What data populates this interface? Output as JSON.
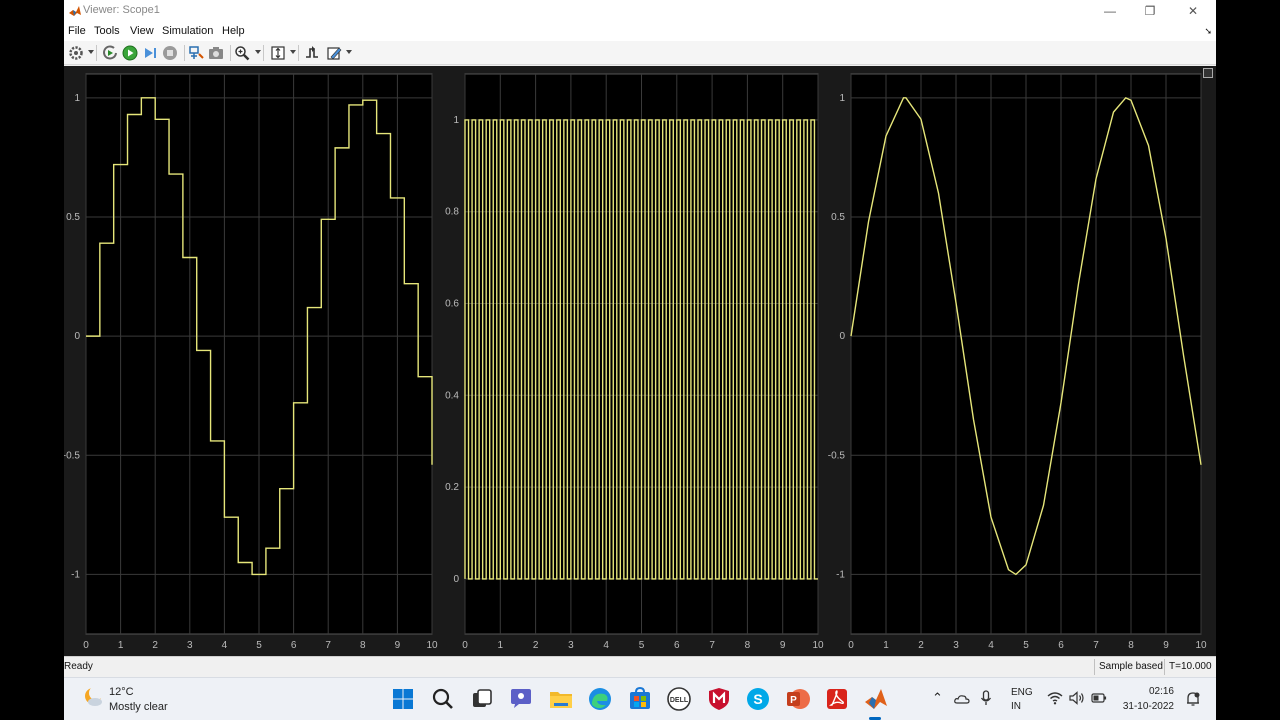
{
  "window": {
    "title": "Viewer: Scope1",
    "minimize": "—",
    "restore": "❐",
    "close": "✕"
  },
  "menu": {
    "items": [
      "File",
      "Tools",
      "View",
      "Simulation",
      "Help"
    ],
    "overflow_arrow": "➘"
  },
  "toolbar": {
    "icons": [
      "gear-icon",
      "run-back-icon",
      "run-icon",
      "step-forward-icon",
      "stop-icon",
      "highlight-block-icon",
      "snapshot-icon",
      "zoom-icon",
      "autoscale-icon",
      "triggers-icon",
      "style-icon"
    ]
  },
  "plots": [
    {
      "name": "staircase-sine",
      "ylim": [
        -1.25,
        1.1
      ],
      "yticks": [
        "1",
        "0.5",
        "0",
        "-0.5",
        "-1"
      ],
      "xticks": [
        "0",
        "1",
        "2",
        "3",
        "4",
        "5",
        "6",
        "7",
        "8",
        "9",
        "10"
      ]
    },
    {
      "name": "pulse-train",
      "ylim": [
        -0.12,
        1.1
      ],
      "yticks": [
        "1",
        "0.8",
        "0.6",
        "0.4",
        "0.2",
        "0"
      ],
      "xticks": [
        "0",
        "1",
        "2",
        "3",
        "4",
        "5",
        "6",
        "7",
        "8",
        "9",
        "10"
      ]
    },
    {
      "name": "sine",
      "ylim": [
        -1.25,
        1.1
      ],
      "yticks": [
        "1",
        "0.5",
        "0",
        "-0.5",
        "-1"
      ],
      "xticks": [
        "0",
        "1",
        "2",
        "3",
        "4",
        "5",
        "6",
        "7",
        "8",
        "9",
        "10"
      ]
    }
  ],
  "chart_data": [
    {
      "type": "line",
      "style": "step",
      "x": [
        0,
        0.4,
        0.8,
        1.2,
        1.6,
        2.0,
        2.4,
        2.8,
        3.2,
        3.6,
        4.0,
        4.4,
        4.8,
        5.2,
        5.6,
        6.0,
        6.4,
        6.8,
        7.2,
        7.6,
        8.0,
        8.4,
        8.8,
        9.2,
        9.6,
        10.0
      ],
      "y": [
        0,
        0.39,
        0.72,
        0.93,
        1.0,
        0.91,
        0.68,
        0.33,
        -0.06,
        -0.44,
        -0.76,
        -0.95,
        -1.0,
        -0.89,
        -0.64,
        -0.28,
        0.12,
        0.49,
        0.79,
        0.97,
        0.99,
        0.85,
        0.58,
        0.22,
        -0.17,
        -0.54
      ],
      "xlim": [
        0,
        10
      ],
      "ylim": [
        -1.25,
        1.1
      ],
      "grid": true,
      "line_color": "#e6e67a"
    },
    {
      "type": "line",
      "style": "pulse",
      "period": 0.2,
      "duty": 0.5,
      "amplitude": 1,
      "xlim": [
        0,
        10
      ],
      "ylim": [
        -0.12,
        1.1
      ],
      "grid": true,
      "line_color": "#e6e67a"
    },
    {
      "type": "line",
      "style": "smooth",
      "function": "sin(x)",
      "x": [
        0,
        0.5,
        1.0,
        1.5,
        1.57,
        2.0,
        2.5,
        3.0,
        3.5,
        4.0,
        4.5,
        4.71,
        5.0,
        5.5,
        6.0,
        6.5,
        7.0,
        7.5,
        7.85,
        8.0,
        8.5,
        9.0,
        9.5,
        10.0
      ],
      "y": [
        0,
        0.48,
        0.84,
        1.0,
        1.0,
        0.91,
        0.6,
        0.14,
        -0.35,
        -0.76,
        -0.98,
        -1.0,
        -0.96,
        -0.71,
        -0.28,
        0.22,
        0.66,
        0.94,
        1.0,
        0.99,
        0.8,
        0.41,
        -0.08,
        -0.54
      ],
      "xlim": [
        0,
        10
      ],
      "ylim": [
        -1.25,
        1.1
      ],
      "grid": true,
      "line_color": "#e6e67a"
    }
  ],
  "status": {
    "ready": "Ready",
    "mode": "Sample based",
    "time": "T=10.000"
  },
  "taskbar": {
    "weather_temp": "12°C",
    "weather_desc": "Mostly clear",
    "icons": [
      "windows-start-icon",
      "search-icon",
      "task-view-icon",
      "chat-icon",
      "file-explorer-icon",
      "edge-browser-icon",
      "store-icon",
      "dell-icon",
      "mcafee-icon",
      "skype-icon",
      "powerpoint-icon",
      "acrobat-icon",
      "matlab-icon"
    ],
    "lang_top": "ENG",
    "lang_bottom": "IN",
    "time": "02:16",
    "date": "31-10-2022"
  }
}
